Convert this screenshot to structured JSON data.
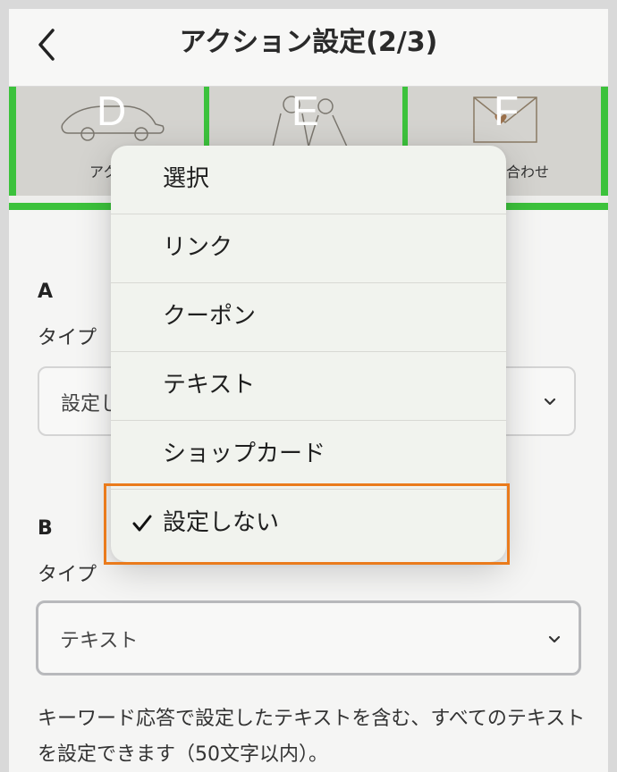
{
  "header": {
    "title": "アクション設定(2/3)",
    "back_icon": "chevron-left-icon"
  },
  "preview": {
    "tiles": [
      {
        "letter": "D",
        "caption": "アク"
      },
      {
        "letter": "E",
        "caption": ""
      },
      {
        "letter": "F",
        "caption": "合わせ"
      }
    ]
  },
  "section_a": {
    "label": "A",
    "type_label": "タイプ",
    "select_value": "設定し"
  },
  "section_b": {
    "label": "B",
    "type_label": "タイプ",
    "select_value": "テキスト"
  },
  "help_text": "キーワード応答で設定したテキストを含む、すべてのテキストを設定できます（50文字以内）。",
  "dropdown": {
    "options": [
      "選択",
      "リンク",
      "クーポン",
      "テキスト",
      "ショップカード",
      "設定しない"
    ],
    "selected": "設定しない"
  },
  "colors": {
    "accent_green": "#3cc23c",
    "highlight_orange": "#ea7b1c"
  }
}
